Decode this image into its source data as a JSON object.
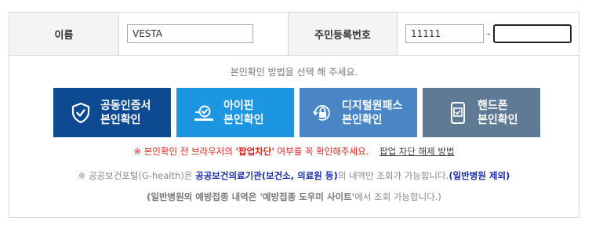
{
  "form": {
    "name_label": "이름",
    "name_value": "VESTA",
    "rrn_label": "주민등록번호",
    "rrn_front_value": "11111",
    "rrn_separator": "-",
    "rrn_back_value": ""
  },
  "guide_text": "본인확인 방법을 선택 해 주세요.",
  "buttons": [
    {
      "line1": "공동인증서",
      "line2": "본인확인",
      "icon": "shield-check-icon",
      "color": "#0d4a91"
    },
    {
      "line1": "아이핀",
      "line2": "본인확인",
      "icon": "ipin-card-check-icon",
      "color": "#1c96e0"
    },
    {
      "line1": "디지털원패스",
      "line2": "본인확인",
      "icon": "digital-onepass-lock-icon",
      "color": "#4a86c6"
    },
    {
      "line1": "핸드폰",
      "line2": "본인확인",
      "icon": "mobile-phone-check-icon",
      "color": "#5e7a95"
    }
  ],
  "warning": {
    "part1": "※ 본인확인 전 브라우저의 ",
    "highlight": "'팝업차단'",
    "part2": " 여부를 꼭 확인해주세요.",
    "link": "팝업 차단 해제 방법"
  },
  "note1": {
    "part1": "※ 공공보건포털(G-health)은 ",
    "bold1": "공공보건의료기관(보건소, 의료원 등)",
    "part2": "의 내역만 조회가 가능합니다.",
    "bold2": "(일반병원 제외)"
  },
  "note2": {
    "b1": "(일반병원의 예방접종 내역은 ",
    "b2": "'예방접종 도우미 사이트'",
    "part": "에서 조회 가능합니다.)"
  },
  "colors": {
    "warning_red": "#d9261c",
    "note_blue": "#1a2ea8"
  }
}
